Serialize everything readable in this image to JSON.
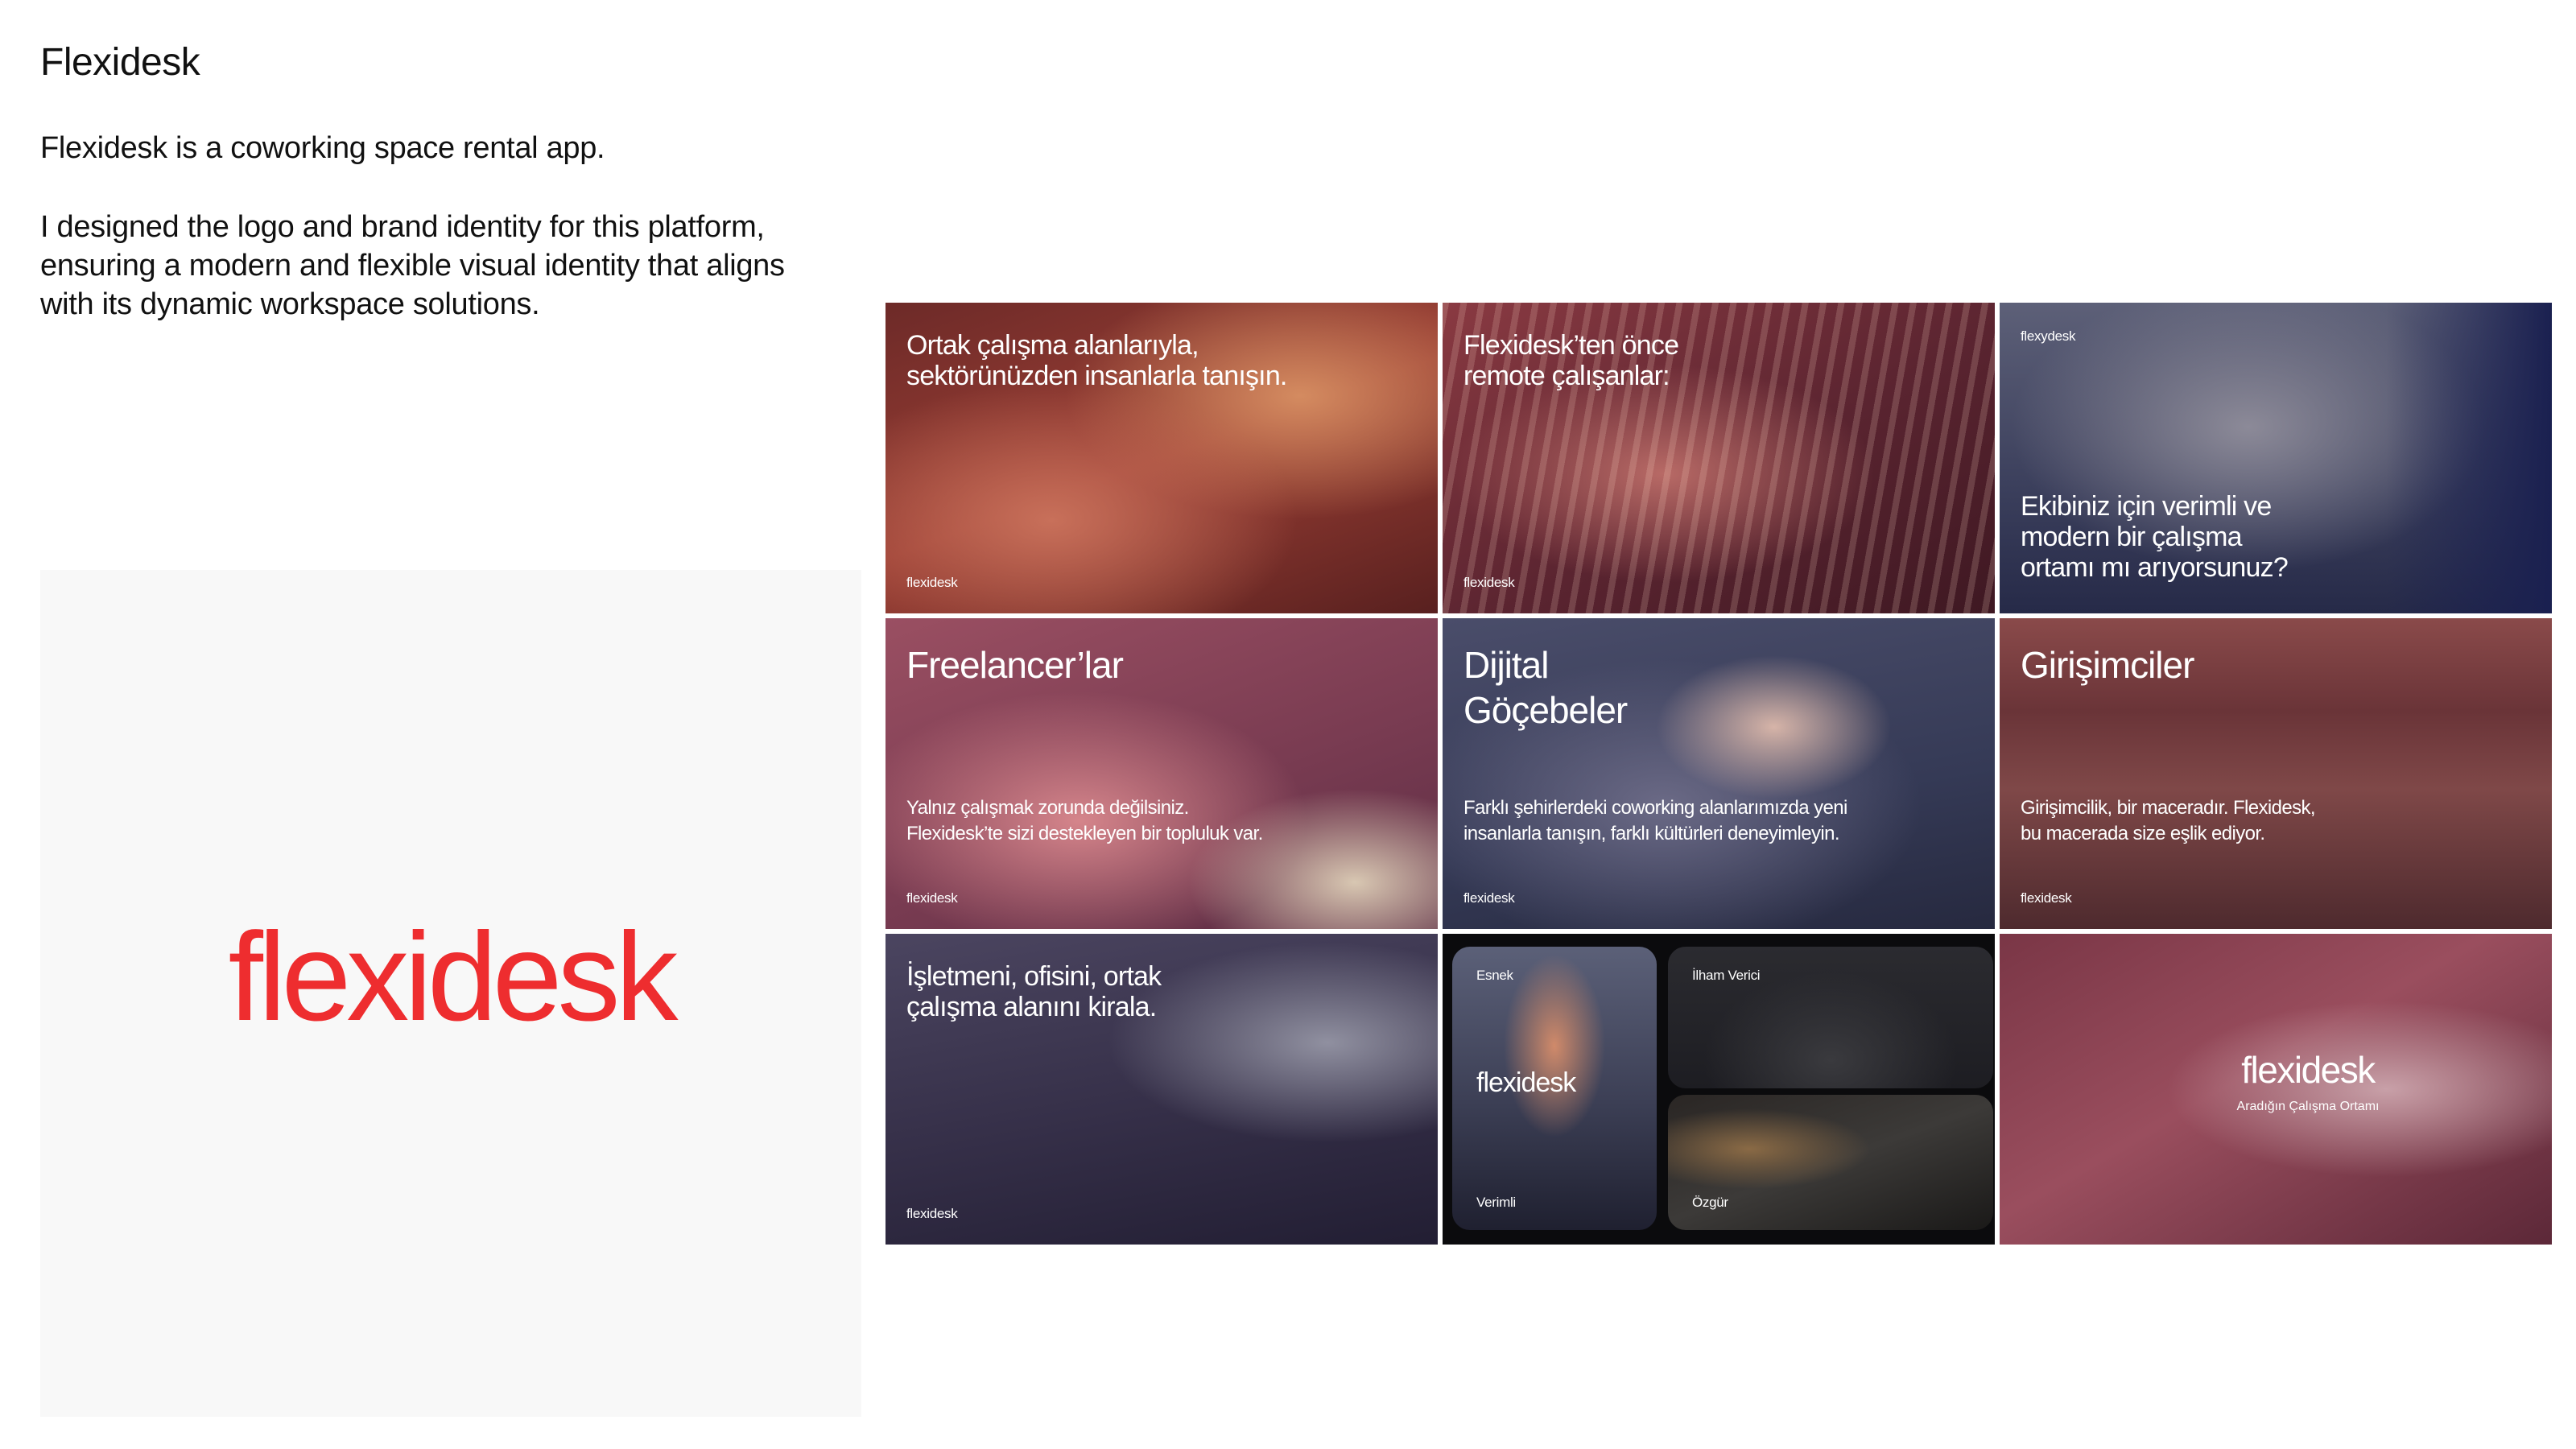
{
  "project": {
    "title": "Flexidesk",
    "intro": "Flexidesk is a coworking space rental app.",
    "description": "I designed the logo and brand identity for this platform, ensuring a modern and flexible visual identity that aligns with its dynamic workspace solutions."
  },
  "logo": {
    "text": "flexidesk",
    "color": "#ee2d2f"
  },
  "tiles": [
    {
      "headline": "Ortak çalışma alanlarıyla,\nsektörünüzden insanlarla tanışın.",
      "brand": "flexidesk"
    },
    {
      "headline": "Flexidesk’ten önce\nremote çalışanlar:",
      "brand": "flexidesk"
    },
    {
      "headline": "Ekibiniz için verimli ve\nmodern bir çalışma\nortamı mı arıyorsunuz?",
      "brand": "flexydesk"
    },
    {
      "headline": "Freelancer’lar",
      "body": "Yalnız çalışmak zorunda değilsiniz.\nFlexidesk’te sizi destekleyen bir topluluk var.",
      "brand": "flexidesk"
    },
    {
      "headline": "Dijital\nGöçebeler",
      "body": "Farklı şehirlerdeki coworking alanlarımızda yeni\ninsanlarla tanışın, farklı kültürleri deneyimleyin.",
      "brand": "flexidesk"
    },
    {
      "headline": "Girişimciler",
      "body": "Girişimcilik, bir maceradır. Flexidesk,\nbu macerada size eşlik ediyor.",
      "brand": "flexidesk"
    },
    {
      "headline": "İşletmeni, ofisini, ortak\nçalışma alanını kirala.",
      "brand": "flexidesk"
    },
    {
      "collage": {
        "esnek": "Esnek",
        "wordmark": "flexidesk",
        "verimli": "Verimli",
        "ilham": "İlham Verici",
        "ozgur": "Özgür"
      }
    },
    {
      "logo": "flexidesk",
      "tagline": "Aradığın Çalışma Ortamı"
    }
  ]
}
